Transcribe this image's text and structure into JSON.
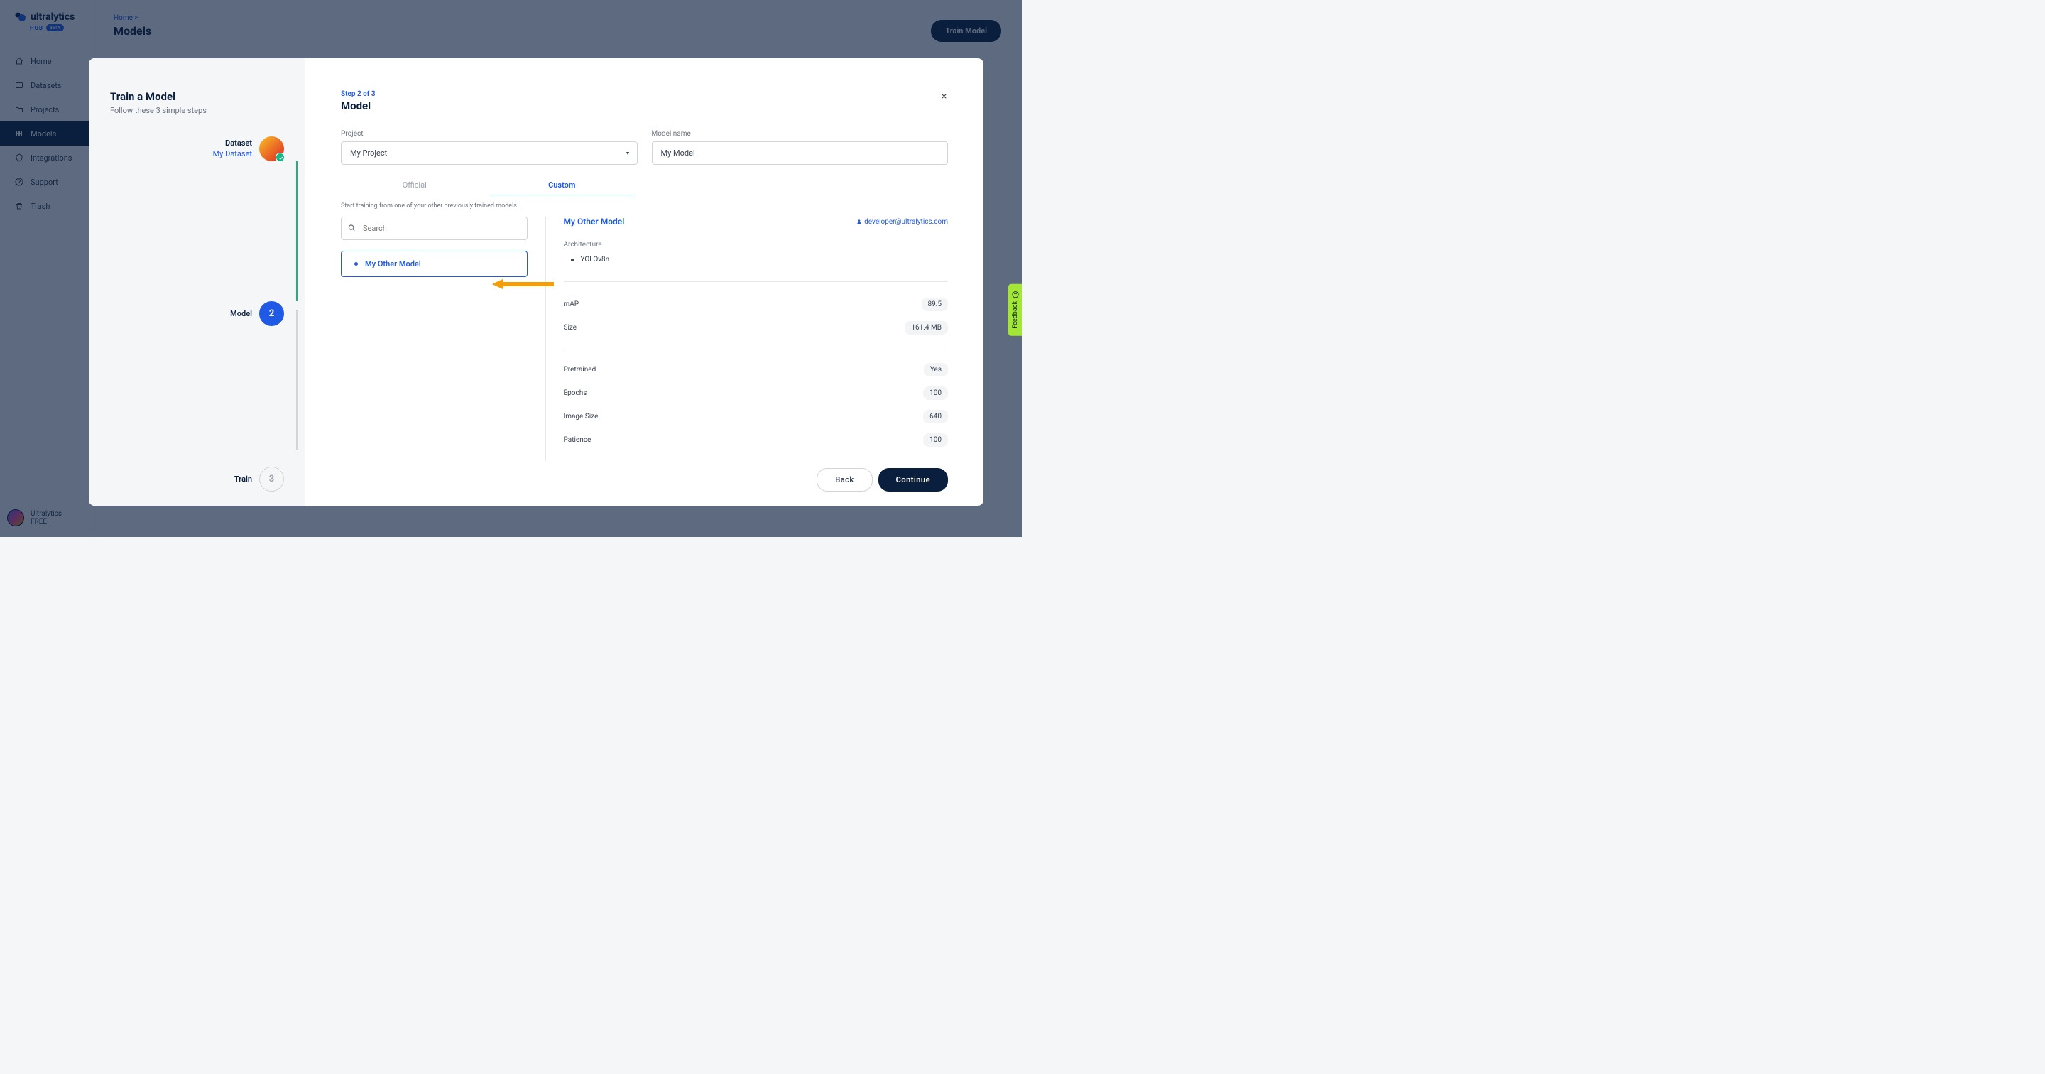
{
  "brand": {
    "name": "ultralytics",
    "hub": "HUB",
    "badge": "BETA"
  },
  "nav": {
    "items": [
      {
        "label": "Home"
      },
      {
        "label": "Datasets"
      },
      {
        "label": "Projects"
      },
      {
        "label": "Models"
      },
      {
        "label": "Integrations"
      },
      {
        "label": "Support"
      },
      {
        "label": "Trash"
      }
    ]
  },
  "user": {
    "name": "Ultralytics",
    "plan": "FREE"
  },
  "breadcrumb": {
    "home": "Home",
    "sep": ">"
  },
  "page": {
    "title": "Models",
    "trainButton": "Train Model"
  },
  "wizard": {
    "title": "Train a Model",
    "subtitle": "Follow these 3 simple steps",
    "steps": [
      {
        "label": "Dataset",
        "sublabel": "My Dataset"
      },
      {
        "label": "Model",
        "number": "2"
      },
      {
        "label": "Train",
        "number": "3"
      }
    ]
  },
  "modal": {
    "stepIndicator": "Step 2 of 3",
    "sectionTitle": "Model",
    "projectLabel": "Project",
    "projectValue": "My Project",
    "modelNameLabel": "Model name",
    "modelNameValue": "My Model",
    "tabs": {
      "official": "Official",
      "custom": "Custom"
    },
    "helperText": "Start training from one of your other previously trained models.",
    "search": {
      "placeholder": "Search"
    },
    "modelList": [
      {
        "name": "My Other Model"
      }
    ],
    "details": {
      "title": "My Other Model",
      "owner": "developer@ultralytics.com",
      "archLabel": "Architecture",
      "archValue": "YOLOv8n",
      "metrics": [
        {
          "label": "mAP",
          "value": "89.5"
        },
        {
          "label": "Size",
          "value": "161.4 MB"
        }
      ],
      "params": [
        {
          "label": "Pretrained",
          "value": "Yes"
        },
        {
          "label": "Epochs",
          "value": "100"
        },
        {
          "label": "Image Size",
          "value": "640"
        },
        {
          "label": "Patience",
          "value": "100"
        }
      ]
    },
    "buttons": {
      "back": "Back",
      "continue": "Continue"
    }
  },
  "feedback": {
    "label": "Feedback"
  }
}
